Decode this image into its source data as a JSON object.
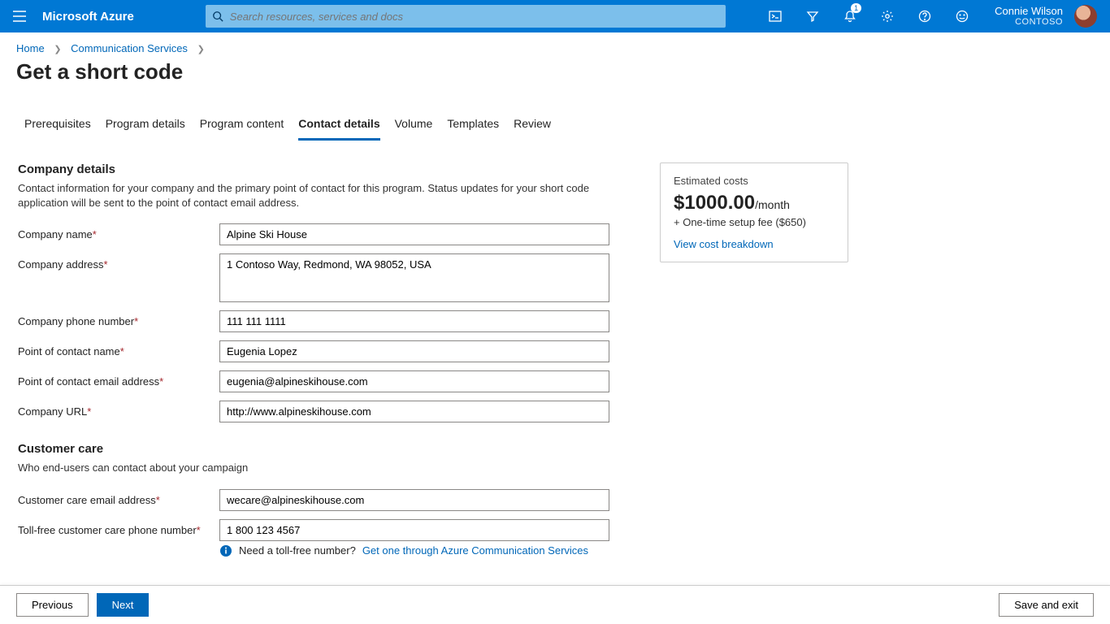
{
  "header": {
    "brand": "Microsoft Azure",
    "search_placeholder": "Search resources, services and docs",
    "notification_count": "1",
    "user_name": "Connie Wilson",
    "tenant": "CONTOSO"
  },
  "breadcrumbs": {
    "home": "Home",
    "svc": "Communication Services"
  },
  "page_title": "Get a short code",
  "tabs": [
    "Prerequisites",
    "Program details",
    "Program content",
    "Contact details",
    "Volume",
    "Templates",
    "Review"
  ],
  "active_tab": "Contact details",
  "company": {
    "section_title": "Company details",
    "section_desc": "Contact information for your company and the primary point of contact for this program. Status updates for your short code application will be sent to the point of contact email address.",
    "name_label": "Company name",
    "name_value": "Alpine Ski House",
    "address_label": "Company address",
    "address_value": "1 Contoso Way, Redmond, WA 98052, USA",
    "phone_label": "Company phone number",
    "phone_value": "111 111 1111",
    "poc_label": "Point of contact name",
    "poc_value": "Eugenia Lopez",
    "poc_email_label": "Point of contact email address",
    "poc_email_value": "eugenia@alpineskihouse.com",
    "url_label": "Company URL",
    "url_value": "http://www.alpineskihouse.com"
  },
  "care": {
    "section_title": "Customer care",
    "section_desc": "Who end-users can contact about your campaign",
    "email_label": "Customer care email address",
    "email_value": "wecare@alpineskihouse.com",
    "toll_label": "Toll-free customer care phone number",
    "toll_value": "1 800 123 4567",
    "helper_q": "Need a toll-free number?",
    "helper_link": "Get one through Azure Communication Services"
  },
  "cost": {
    "label": "Estimated costs",
    "amount": "$1000.00",
    "per": "/month",
    "setup": "+ One-time setup fee ($650)",
    "link": "View cost breakdown"
  },
  "footer": {
    "prev": "Previous",
    "next": "Next",
    "save": "Save and exit"
  }
}
